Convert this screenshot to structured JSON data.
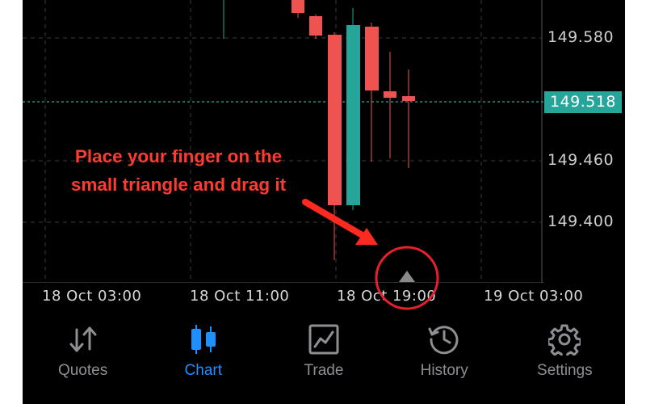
{
  "chart": {
    "price_axis": [
      "149.580",
      "149.460",
      "149.400"
    ],
    "current_price": "149.518",
    "time_axis": [
      "18 Oct 03:00",
      "18 Oct 11:00",
      "18 Oct 19:00",
      "19 Oct 03:00"
    ]
  },
  "annotation": {
    "line1": "Place your finger on the",
    "line2": "small triangle and drag it"
  },
  "tabs": [
    {
      "label": "Quotes",
      "icon": "quotes-arrows-icon",
      "active": false
    },
    {
      "label": "Chart",
      "icon": "candlestick-icon",
      "active": true
    },
    {
      "label": "Trade",
      "icon": "trade-chart-icon",
      "active": false
    },
    {
      "label": "History",
      "icon": "history-clock-icon",
      "active": false
    },
    {
      "label": "Settings",
      "icon": "gear-icon",
      "active": false
    }
  ],
  "colors": {
    "bullish": "#26a69a",
    "bearish": "#ef5350",
    "active_tab": "#1e8fff",
    "inactive_tab": "#8e8e93",
    "annotation": "#ff3b30"
  }
}
